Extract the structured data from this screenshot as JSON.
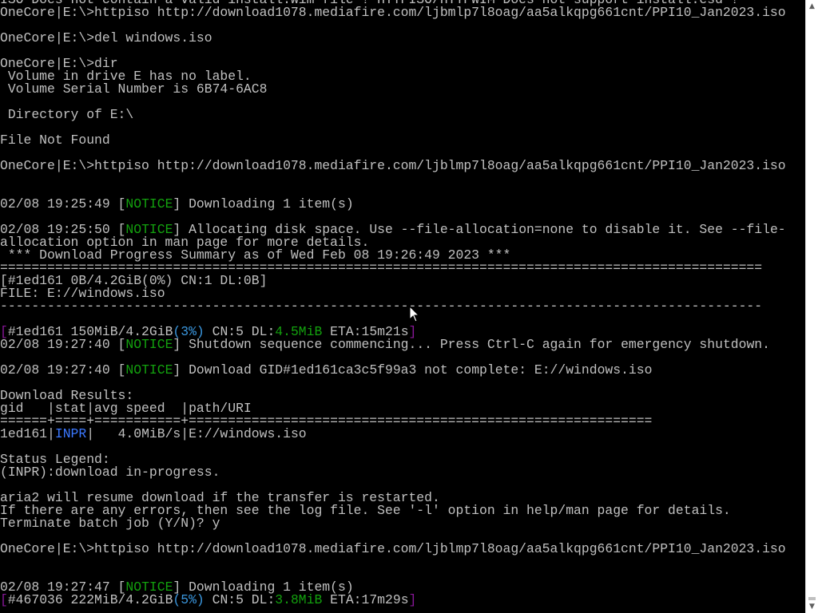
{
  "console_lines": [
    {
      "segments": [
        {
          "text": "ISO Does not contain a valid install.wim file ! HTTPISO/HTTPWIM Does not support install.esd !",
          "color": "default"
        }
      ]
    },
    {
      "segments": [
        {
          "text": "OneCore|E:\\>httpiso http://download1078.mediafire.com/ljbmlp7l8oag/aa5alkqpg661cnt/PPI10_Jan2023.iso",
          "color": "default"
        }
      ]
    },
    {
      "segments": []
    },
    {
      "segments": [
        {
          "text": "OneCore|E:\\>del windows.iso",
          "color": "default"
        }
      ]
    },
    {
      "segments": []
    },
    {
      "segments": [
        {
          "text": "OneCore|E:\\>dir",
          "color": "default"
        }
      ]
    },
    {
      "segments": [
        {
          "text": " Volume in drive E has no label.",
          "color": "default"
        }
      ]
    },
    {
      "segments": [
        {
          "text": " Volume Serial Number is 6B74-6AC8",
          "color": "default"
        }
      ]
    },
    {
      "segments": []
    },
    {
      "segments": [
        {
          "text": " Directory of E:\\",
          "color": "default"
        }
      ]
    },
    {
      "segments": []
    },
    {
      "segments": [
        {
          "text": "File Not Found",
          "color": "default"
        }
      ]
    },
    {
      "segments": []
    },
    {
      "segments": [
        {
          "text": "OneCore|E:\\>httpiso http://download1078.mediafire.com/ljblmp7l8oag/aa5alkqpg661cnt/PPI10_Jan2023.iso",
          "color": "default"
        }
      ]
    },
    {
      "segments": []
    },
    {
      "segments": []
    },
    {
      "segments": [
        {
          "text": "02/08 19:25:49 [",
          "color": "default"
        },
        {
          "text": "NOTICE",
          "color": "notice"
        },
        {
          "text": "] Downloading 1 item(s)",
          "color": "default"
        }
      ]
    },
    {
      "segments": []
    },
    {
      "segments": [
        {
          "text": "02/08 19:25:50 [",
          "color": "default"
        },
        {
          "text": "NOTICE",
          "color": "notice"
        },
        {
          "text": "] Allocating disk space. Use --file-allocation=none to disable it. See --file-",
          "color": "default"
        }
      ]
    },
    {
      "segments": [
        {
          "text": "allocation option in man page for more details.",
          "color": "default"
        }
      ]
    },
    {
      "segments": [
        {
          "text": " *** Download Progress Summary as of Wed Feb 08 19:26:49 2023 ***",
          "color": "default"
        }
      ]
    },
    {
      "segments": [
        {
          "text": "=================================================================================================",
          "color": "default"
        }
      ]
    },
    {
      "segments": [
        {
          "text": "[#1ed161 0B/4.2GiB(0%) CN:1 DL:0B]",
          "color": "default"
        }
      ]
    },
    {
      "segments": [
        {
          "text": "FILE: E://windows.iso",
          "color": "default"
        }
      ]
    },
    {
      "segments": [
        {
          "text": "-------------------------------------------------------------------------------------------------",
          "color": "default"
        }
      ]
    },
    {
      "segments": []
    },
    {
      "segments": [
        {
          "text": "[",
          "color": "magenta"
        },
        {
          "text": "#1ed161 150MiB/4.2GiB",
          "color": "default"
        },
        {
          "text": "(3%)",
          "color": "cyan"
        },
        {
          "text": " CN:5 DL:",
          "color": "default"
        },
        {
          "text": "4.5MiB",
          "color": "green"
        },
        {
          "text": " ETA:15m21s",
          "color": "default"
        },
        {
          "text": "]",
          "color": "magenta"
        }
      ]
    },
    {
      "segments": [
        {
          "text": "02/08 19:27:40 [",
          "color": "default"
        },
        {
          "text": "NOTICE",
          "color": "notice"
        },
        {
          "text": "] Shutdown sequence commencing... Press Ctrl-C again for emergency shutdown.",
          "color": "default"
        }
      ]
    },
    {
      "segments": []
    },
    {
      "segments": [
        {
          "text": "02/08 19:27:40 [",
          "color": "default"
        },
        {
          "text": "NOTICE",
          "color": "notice"
        },
        {
          "text": "] Download GID#1ed161ca3c5f99a3 not complete: E://windows.iso",
          "color": "default"
        }
      ]
    },
    {
      "segments": []
    },
    {
      "segments": [
        {
          "text": "Download Results:",
          "color": "default"
        }
      ]
    },
    {
      "segments": [
        {
          "text": "gid   |stat|avg speed  |path/URI",
          "color": "default"
        }
      ]
    },
    {
      "segments": [
        {
          "text": "======+====+===========+===========================================================",
          "color": "default"
        }
      ]
    },
    {
      "segments": [
        {
          "text": "1ed161|",
          "color": "default"
        },
        {
          "text": "INPR",
          "color": "blue"
        },
        {
          "text": "|   4.0MiB/s|E://windows.iso",
          "color": "default"
        }
      ]
    },
    {
      "segments": []
    },
    {
      "segments": [
        {
          "text": "Status Legend:",
          "color": "default"
        }
      ]
    },
    {
      "segments": [
        {
          "text": "(INPR):download in-progress.",
          "color": "default"
        }
      ]
    },
    {
      "segments": []
    },
    {
      "segments": [
        {
          "text": "aria2 will resume download if the transfer is restarted.",
          "color": "default"
        }
      ]
    },
    {
      "segments": [
        {
          "text": "If there are any errors, then see the log file. See '-l' option in help/man page for details.",
          "color": "default"
        }
      ]
    },
    {
      "segments": [
        {
          "text": "Terminate batch job (Y/N)? y",
          "color": "default"
        }
      ]
    },
    {
      "segments": []
    },
    {
      "segments": [
        {
          "text": "OneCore|E:\\>httpiso http://download1078.mediafire.com/ljblmp7l8oag/aa5alkqpg661cnt/PPI10_Jan2023.iso",
          "color": "default"
        }
      ]
    },
    {
      "segments": []
    },
    {
      "segments": []
    },
    {
      "segments": [
        {
          "text": "02/08 19:27:47 [",
          "color": "default"
        },
        {
          "text": "NOTICE",
          "color": "notice"
        },
        {
          "text": "] Downloading 1 item(s)",
          "color": "default"
        }
      ]
    },
    {
      "segments": [
        {
          "text": "[",
          "color": "magenta"
        },
        {
          "text": "#467036 222MiB/4.2GiB",
          "color": "default"
        },
        {
          "text": "(5%)",
          "color": "cyan"
        },
        {
          "text": " CN:5 DL:",
          "color": "default"
        },
        {
          "text": "3.8MiB",
          "color": "green"
        },
        {
          "text": " ETA:17m29s",
          "color": "default"
        },
        {
          "text": "]",
          "color": "magenta"
        }
      ]
    }
  ],
  "scrollbar": {
    "up_arrow_icon": "triangle-up-icon",
    "down_arrow_icon": "triangle-down-icon"
  },
  "colors": {
    "background": "#000000",
    "default_text": "#c0c0c0",
    "notice": "#13a10e",
    "magenta": "#881798",
    "cyan": "#3a96dd",
    "blue": "#3b78ff"
  }
}
